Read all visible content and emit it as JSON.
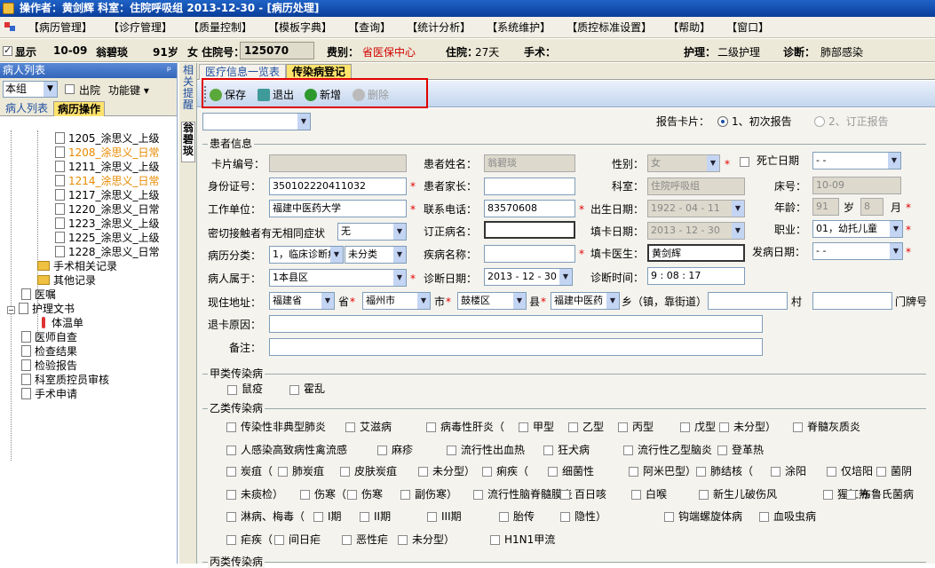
{
  "titlebar": {
    "text": "操作者：黄剑辉   科室：住院呼吸组   2013-12-30 - [病历处理]"
  },
  "menu": [
    "【病历管理】",
    "【诊疗管理】",
    "【质量控制】",
    "【模板字典】",
    "【查询】",
    "【统计分析】",
    "【系统维护】",
    "【质控标准设置】",
    "【帮助】",
    "【窗口】"
  ],
  "patient": {
    "show": "显示",
    "date": "10-09",
    "name": "翁碧琰",
    "age": "91岁",
    "hosp_no_label": "女 住院号：",
    "hosp_no": "125070",
    "fee_label": "费别：",
    "fee": "省医保中心",
    "stay_label": "住院：",
    "stay": "27天",
    "surgery_label": "手术：",
    "care_label": "护理：",
    "care": "二级护理",
    "diag_label": "诊断：",
    "diag": "肺部感染"
  },
  "left": {
    "title": "病人列表",
    "pin": "ᵖ",
    "group": "本组",
    "discharged": "出院",
    "func": "功能键 ▾",
    "tabs": [
      "病人列表",
      "病历操作"
    ],
    "tree": [
      "1205_涂思义_上级",
      "1208_涂思义_日常",
      "1211_涂思义_上级",
      "1214_涂思义_日常",
      "1217_涂思义_上级",
      "1220_涂思义_日常",
      "1223_涂思义_上级",
      "1225_涂思义_上级",
      "1228_涂思义_日常"
    ],
    "folders": [
      "手术相关记录",
      "其他记录"
    ],
    "nodes": [
      "医嘱",
      "护理文书",
      "体温单",
      "医师自查",
      "检查结果",
      "检验报告",
      "科室质控员审核",
      "手术申请"
    ]
  },
  "vtabs": [
    "相关提醒",
    "翁碧琰"
  ],
  "tabs": [
    "医疗信息一览表",
    "传染病登记"
  ],
  "toolbar": {
    "save": "保存",
    "exit": "退出",
    "add": "新增",
    "delete": "删除"
  },
  "report": {
    "label": "报告卡片：",
    "opt1": "1、初次报告",
    "opt2": "2、订正报告"
  },
  "form": {
    "section_patient": "患者信息",
    "card_no": "卡片编号：",
    "pname": "患者姓名：",
    "pname_v": "翁碧琰",
    "sex": "性别：",
    "sex_v": "女",
    "death": "死亡日期",
    "death_v": " -  - ",
    "idcard": "身份证号：",
    "idcard_v": "350102220411032",
    "parent": "患者家长：",
    "dept": "科室：",
    "dept_v": "住院呼吸组",
    "bed": "床号：",
    "bed_v": "10-09",
    "work": "工作单位：",
    "work_v": "福建中医药大学",
    "phone": "联系电话：",
    "phone_v": "83570608",
    "birth": "出生日期：",
    "birth_v": "1922 - 04 - 11",
    "agel": "年龄：",
    "age_y": "91",
    "year": "岁",
    "age_m": "8",
    "month": "月",
    "contact": "密切接触者有无相同症状",
    "contact_v": "无",
    "revise": "订正病名：",
    "fill_date": "填卡日期：",
    "fill_date_v": "2013 - 12 - 30",
    "job": "职业：",
    "job_v": "01，幼托儿童",
    "cls": "病历分类：",
    "cls_v1": "1，临床诊断病",
    "cls_v2": "未分类",
    "disease": "疾病名称：",
    "doctor": "填卡医生：",
    "doctor_v": "黄剑辉",
    "onset": "发病日期：",
    "onset_v": " -  - ",
    "belong": "病人属于：",
    "belong_v": "1本县区",
    "diag_date": "诊断日期：",
    "diag_date_v": "2013 - 12 - 30",
    "diag_time": "诊断时间：",
    "diag_time_v": "9 : 08 : 17",
    "addr": "现住地址：",
    "prov": "福建省",
    "provl": "省",
    "city": "福州市",
    "cityl": "市",
    "county": "鼓楼区",
    "countyl": "县",
    "town": "福建中医药",
    "townl": "乡（镇，靠街道）",
    "village": "村",
    "door": "门牌号",
    "reason": "退卡原因：",
    "note": "备注："
  },
  "classA": {
    "title": "甲类传染病",
    "items": [
      "鼠疫",
      "霍乱"
    ]
  },
  "classB": {
    "title": "乙类传染病",
    "rows": [
      [
        "传染性非典型肺炎",
        "艾滋病",
        "病毒性肝炎（",
        "甲型",
        "乙型",
        "丙型",
        "戊型",
        "未分型）",
        "脊髓灰质炎"
      ],
      [
        "人感染高致病性禽流感",
        "麻疹",
        "流行性出血热",
        "狂犬病",
        "流行性乙型脑炎",
        "登革热"
      ],
      [
        "炭疽（",
        "肺炭疽",
        "皮肤炭疽",
        "未分型）",
        "痢疾（",
        "细菌性",
        "阿米巴型）",
        "肺结核（",
        "涂阳",
        "仅培阳",
        "菌阴"
      ],
      [
        "未痰检）",
        "伤寒（",
        "伤寒",
        "副伤寒）",
        "流行性脑脊髓膜炎",
        "百日咳",
        "白喉",
        "新生儿破伤风",
        "猩红热",
        "布鲁氏菌病"
      ],
      [
        "淋病、梅毒（",
        "I期",
        "II期",
        "III期",
        "胎传",
        "隐性）",
        "钩端螺旋体病",
        "血吸虫病"
      ],
      [
        "疟疾（",
        "间日疟",
        "恶性疟",
        "未分型）",
        "H1N1甲流"
      ]
    ]
  },
  "classC": {
    "title": "丙类传染病"
  }
}
